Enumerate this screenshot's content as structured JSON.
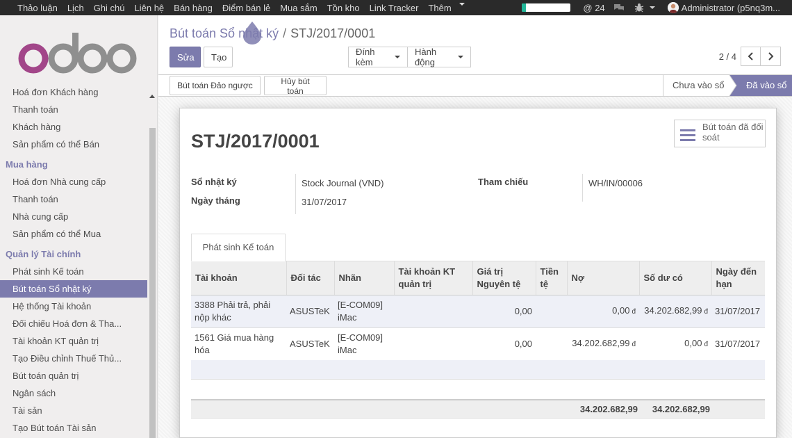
{
  "topbar": {
    "menus": [
      "Thảo luận",
      "Lịch",
      "Ghi chú",
      "Liên hệ",
      "Bán hàng",
      "Điểm bán lẻ",
      "Mua sắm",
      "Tồn kho",
      "Link Tracker",
      "Thêm"
    ],
    "progress_fraction": 0.08,
    "mentions_count": "24",
    "user": "Administrator (p5nq3m..."
  },
  "colors": {
    "brand": "#7c7bad",
    "topbar": "#2a2a2a",
    "progress": "#21b799",
    "logo_o": "#a24689",
    "logo_gray": "#8f8f8f"
  },
  "sidebar": {
    "items": [
      {
        "type": "item",
        "label": "Hoá đơn Khách hàng"
      },
      {
        "type": "item",
        "label": "Thanh toán"
      },
      {
        "type": "item",
        "label": "Khách hàng"
      },
      {
        "type": "item",
        "label": "Sản phẩm có thể Bán"
      },
      {
        "type": "head",
        "label": "Mua hàng"
      },
      {
        "type": "item",
        "label": "Hoá đơn Nhà cung cấp"
      },
      {
        "type": "item",
        "label": "Thanh toán"
      },
      {
        "type": "item",
        "label": "Nhà cung cấp"
      },
      {
        "type": "item",
        "label": "Sản phẩm có thể Mua"
      },
      {
        "type": "head",
        "label": "Quản lý Tài chính"
      },
      {
        "type": "item",
        "label": "Phát sinh Kế toán"
      },
      {
        "type": "item",
        "label": "Bút toán Sổ nhật ký",
        "active": true
      },
      {
        "type": "item",
        "label": "Hệ thống Tài khoản"
      },
      {
        "type": "item",
        "label": "Đối chiếu Hoá đơn & Tha..."
      },
      {
        "type": "item",
        "label": "Tài khoản KT quản trị"
      },
      {
        "type": "item",
        "label": "Tạo Điều chỉnh Thuế Thủ..."
      },
      {
        "type": "item",
        "label": "Bút toán quản trị"
      },
      {
        "type": "item",
        "label": "Ngân sách"
      },
      {
        "type": "item",
        "label": "Tài sản"
      },
      {
        "type": "item",
        "label": "Tạo Bút toán Tài sản"
      }
    ]
  },
  "breadcrumb": {
    "parent": "Bút toán Sổ nhật ký",
    "sep": "/",
    "current": "STJ/2017/0001"
  },
  "buttons": {
    "edit": "Sửa",
    "create": "Tạo",
    "attach": "Đính kèm",
    "action": "Hành động"
  },
  "pager": {
    "value": "2 / 4"
  },
  "statusbar": {
    "reverse": "Bút toán Đảo ngược",
    "cancel": "Hủy bút toán",
    "stages": [
      "Chưa vào sổ",
      "Đã vào sổ"
    ]
  },
  "form": {
    "reconciled_btn": "Bút toán đã đối soát",
    "title": "STJ/2017/0001",
    "journal_label": "Sổ nhật ký",
    "journal_value": "Stock Journal (VND)",
    "date_label": "Ngày tháng",
    "date_value": "31/07/2017",
    "ref_label": "Tham chiếu",
    "ref_value": "WH/IN/00006",
    "tab": "Phát sinh Kế toán"
  },
  "lines": {
    "headers": [
      "Tài khoản",
      "Đối tác",
      "Nhãn",
      "Tài khoản KT quản trị",
      "Giá trị Nguyên tệ",
      "Tiền tệ",
      "Nợ",
      "Số dư có",
      "Ngày đến hạn"
    ],
    "currency_symbol": "đ",
    "rows": [
      {
        "account": "3388 Phải trả, phải nộp khác",
        "partner": "ASUSTeK",
        "label": "[E-COM09] iMac",
        "analytic": "",
        "amount_currency": "0,00",
        "currency": "",
        "debit": "0,00",
        "credit": "34.202.682,99",
        "date_maturity": "31/07/2017"
      },
      {
        "account": "1561 Giá mua hàng hóa",
        "partner": "ASUSTeK",
        "label": "[E-COM09] iMac",
        "analytic": "",
        "amount_currency": "0,00",
        "currency": "",
        "debit": "34.202.682,99",
        "credit": "0,00",
        "date_maturity": "31/07/2017"
      }
    ],
    "total_debit": "34.202.682,99",
    "total_credit": "34.202.682,99"
  }
}
